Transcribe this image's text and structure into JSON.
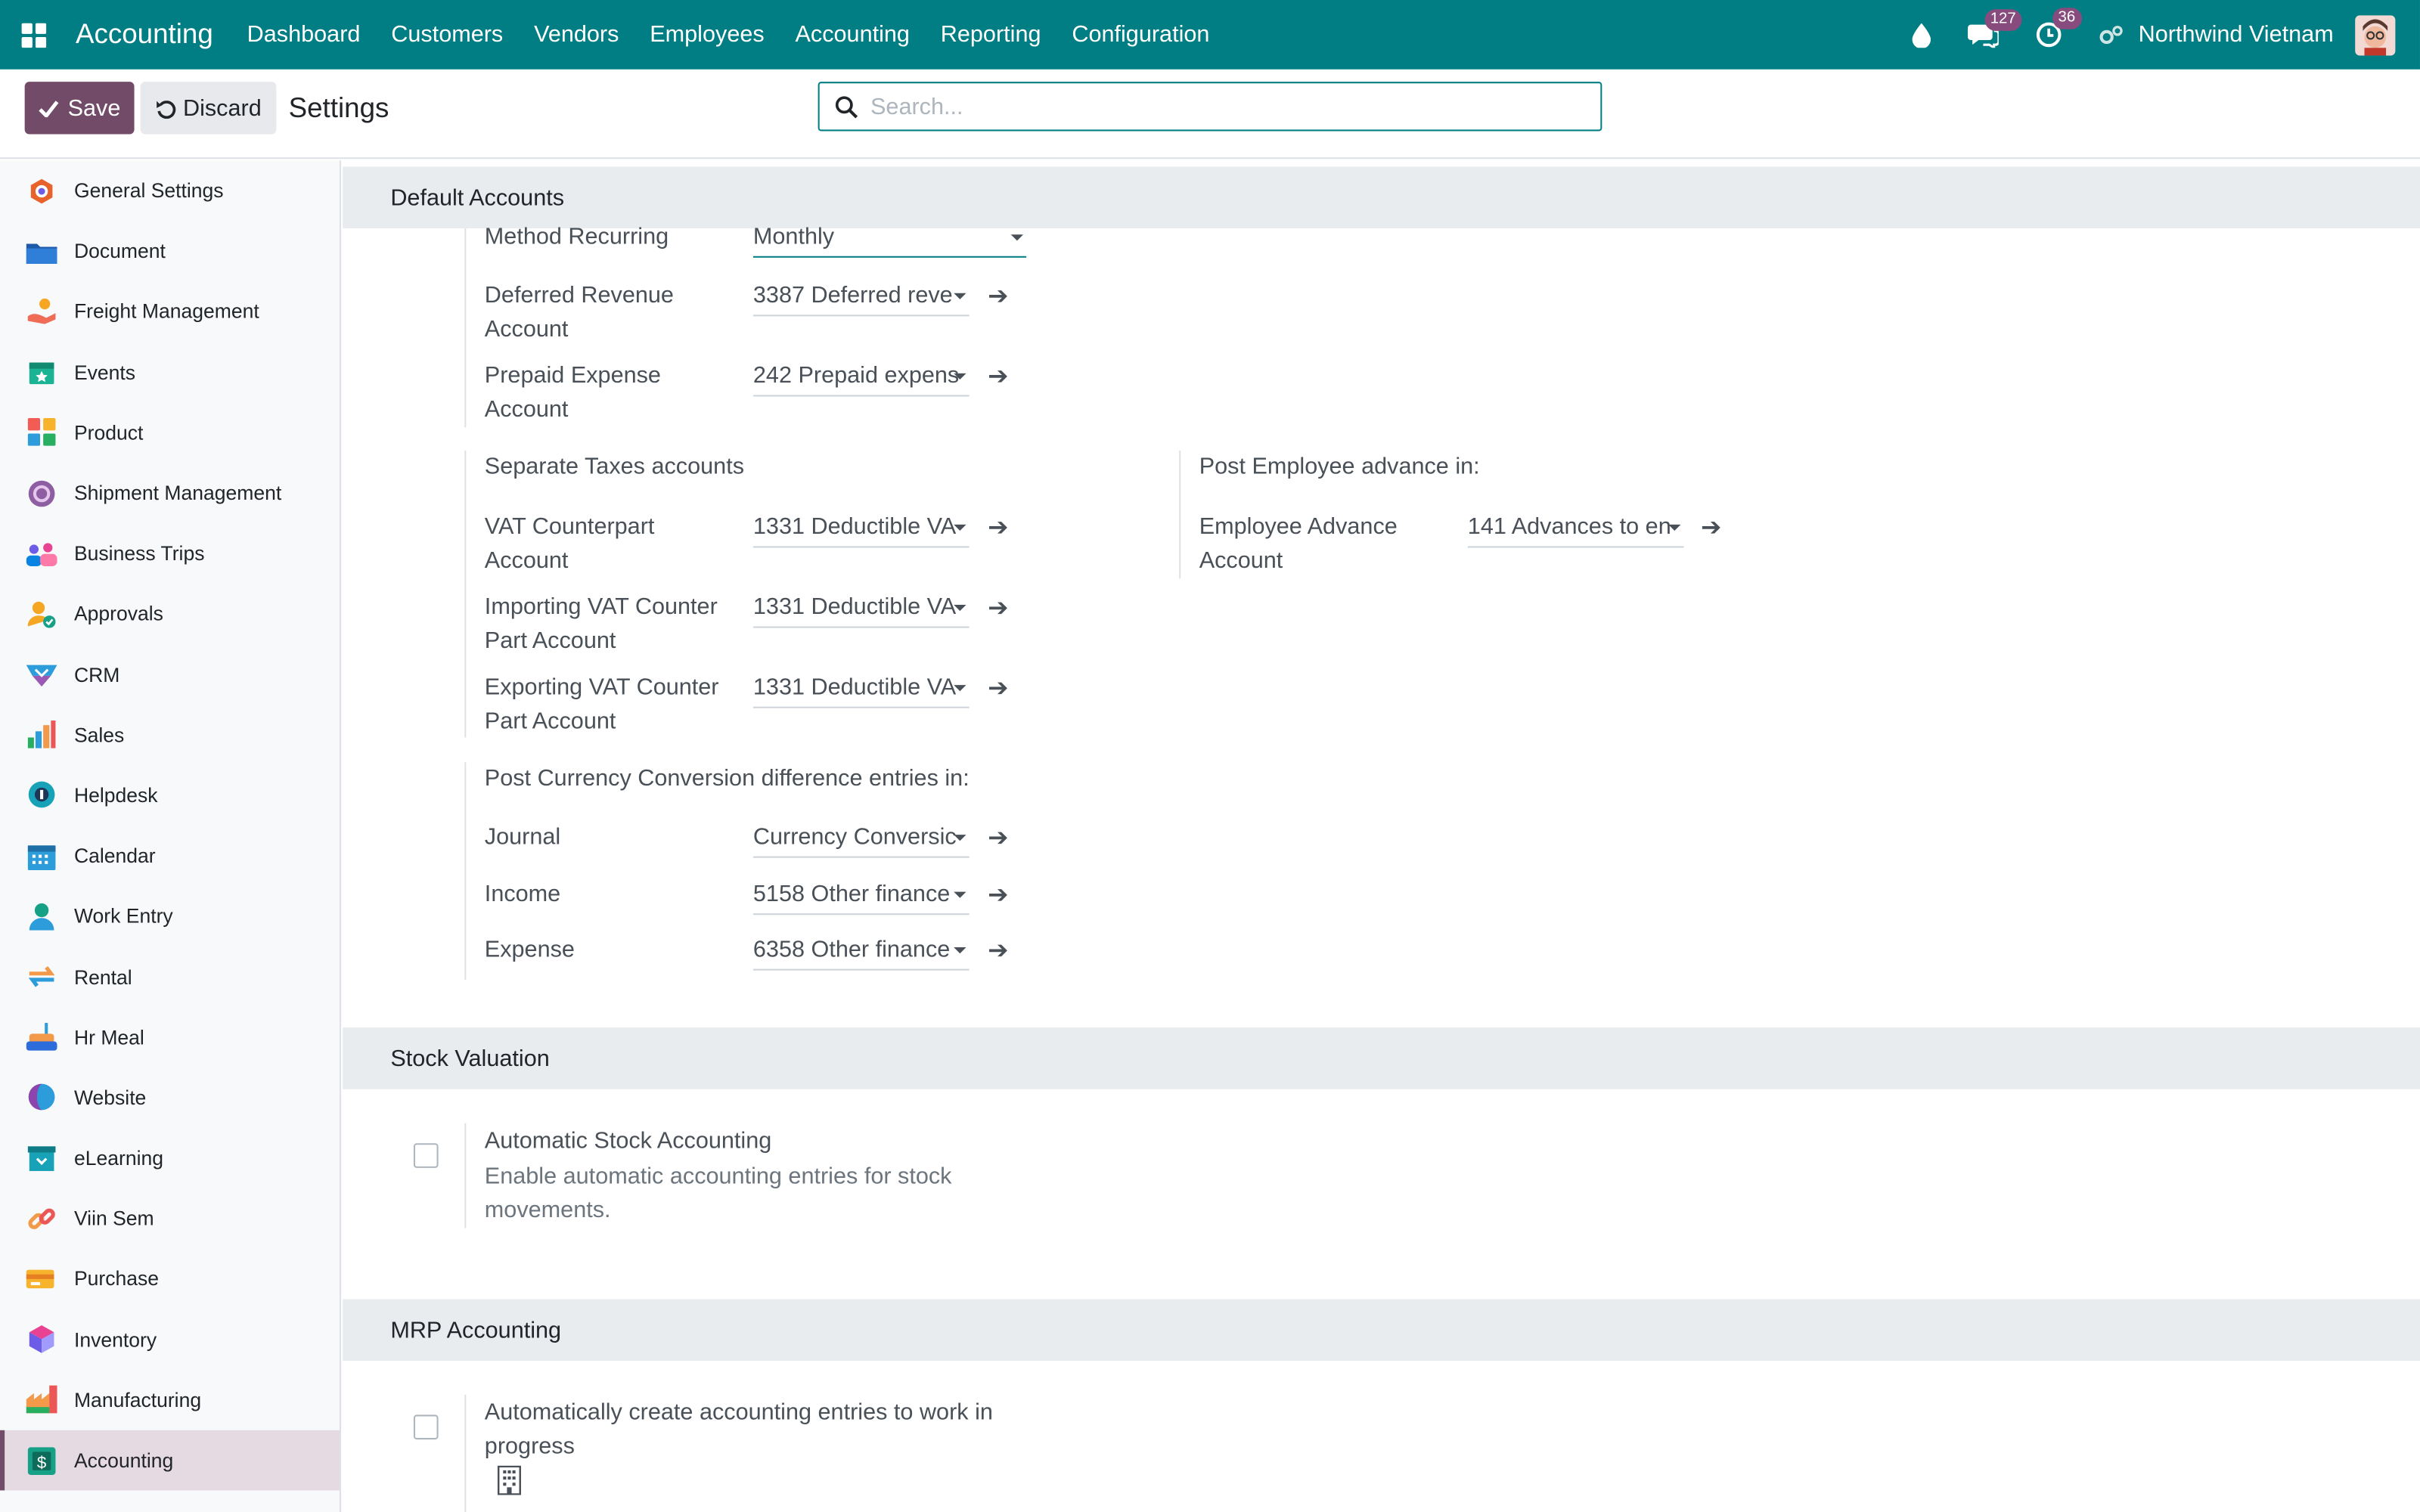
{
  "navbar": {
    "app_name": "Accounting",
    "menu": [
      "Dashboard",
      "Customers",
      "Vendors",
      "Employees",
      "Accounting",
      "Reporting",
      "Configuration"
    ],
    "messages_count": "127",
    "activities_count": "36",
    "company": "Northwind Vietnam",
    "colors": {
      "primary": "#017e84",
      "badge": "#874c7d"
    }
  },
  "control_panel": {
    "save_label": "Save",
    "discard_label": "Discard",
    "breadcrumb": "Settings",
    "search_placeholder": "Search..."
  },
  "sidebar": {
    "items": [
      {
        "label": "General Settings",
        "icon": "general-settings-icon"
      },
      {
        "label": "Document",
        "icon": "document-icon"
      },
      {
        "label": "Freight Management",
        "icon": "freight-icon"
      },
      {
        "label": "Events",
        "icon": "events-icon"
      },
      {
        "label": "Product",
        "icon": "product-icon"
      },
      {
        "label": "Shipment Management",
        "icon": "shipment-icon"
      },
      {
        "label": "Business Trips",
        "icon": "business-trips-icon"
      },
      {
        "label": "Approvals",
        "icon": "approvals-icon"
      },
      {
        "label": "CRM",
        "icon": "crm-icon"
      },
      {
        "label": "Sales",
        "icon": "sales-icon"
      },
      {
        "label": "Helpdesk",
        "icon": "helpdesk-icon"
      },
      {
        "label": "Calendar",
        "icon": "calendar-icon"
      },
      {
        "label": "Work Entry",
        "icon": "work-entry-icon"
      },
      {
        "label": "Rental",
        "icon": "rental-icon"
      },
      {
        "label": "Hr Meal",
        "icon": "hr-meal-icon"
      },
      {
        "label": "Website",
        "icon": "website-icon"
      },
      {
        "label": "eLearning",
        "icon": "elearning-icon"
      },
      {
        "label": "Viin Sem",
        "icon": "viin-sem-icon"
      },
      {
        "label": "Purchase",
        "icon": "purchase-icon"
      },
      {
        "label": "Inventory",
        "icon": "inventory-icon"
      },
      {
        "label": "Manufacturing",
        "icon": "manufacturing-icon"
      },
      {
        "label": "Accounting",
        "icon": "accounting-icon",
        "active": true
      }
    ]
  },
  "default_accounts": {
    "heading": "Default Accounts",
    "method_recurring": {
      "label": "Method Recurring",
      "value": "Monthly"
    },
    "deferred_revenue": {
      "label": "Deferred Revenue Account",
      "value": "3387 Deferred reve"
    },
    "prepaid_expense": {
      "label": "Prepaid Expense Account",
      "value": "242 Prepaid expens"
    },
    "separate_taxes": {
      "title": "Separate Taxes accounts",
      "vat_counterpart": {
        "label": "VAT Counterpart Account",
        "value": "1331 Deductible VA"
      },
      "importing_vat": {
        "label": "Importing VAT Counter Part Account",
        "value": "1331 Deductible VA"
      },
      "exporting_vat": {
        "label": "Exporting VAT Counter Part Account",
        "value": "1331 Deductible VA"
      }
    },
    "employee_advance": {
      "title": "Post Employee advance in:",
      "account": {
        "label": "Employee Advance Account",
        "value": "141 Advances to en"
      }
    },
    "currency_conversion": {
      "title": "Post Currency Conversion difference entries in:",
      "journal": {
        "label": "Journal",
        "value": "Currency Conversic"
      },
      "income": {
        "label": "Income",
        "value": "5158 Other finance"
      },
      "expense": {
        "label": "Expense",
        "value": "6358 Other finance"
      }
    }
  },
  "stock_valuation": {
    "heading": "Stock Valuation",
    "automatic": {
      "title": "Automatic Stock Accounting",
      "description": "Enable automatic accounting entries for stock movements.",
      "checked": false
    }
  },
  "mrp_accounting": {
    "heading": "MRP Accounting",
    "wip": {
      "title": "Automatically create accounting entries to work in progress",
      "checked": false
    }
  }
}
